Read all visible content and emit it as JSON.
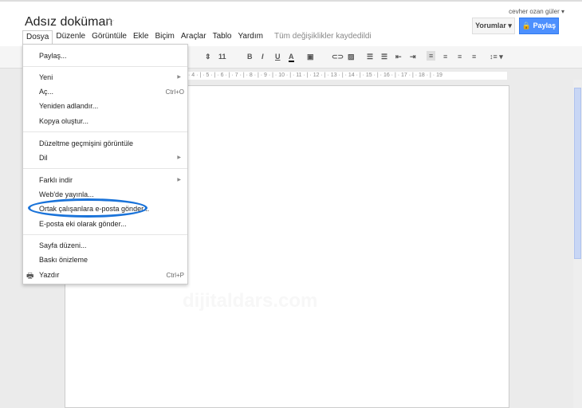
{
  "doc": {
    "title": "Adsız doküman",
    "star_icon": "star-icon"
  },
  "account": {
    "user": "cevher ozan güler ▾"
  },
  "buttons": {
    "comments": "Yorumlar ▾",
    "share": "Paylaş",
    "share_color": "#4d90fe"
  },
  "menubar": [
    "Dosya",
    "Düzenle",
    "Görüntüle",
    "Ekle",
    "Biçim",
    "Araçlar",
    "Tablo",
    "Yardım"
  ],
  "status": "Tüm değişiklikler kaydedildi",
  "toolbar": {
    "font_size": "11",
    "bold": "B",
    "italic": "I",
    "underline": "U",
    "text_color": "A"
  },
  "ruler": "· 4 · | · 5 · | · 6 · | · 7 · | · 8 · | · 9 · | · 10 · | · 11 · | · 12 · | · 13 · | · 14 · | · 15 · | · 16 · | · 17 · | · 18 · | · 19",
  "watermark": "dijitaldars.com",
  "file_menu": [
    {
      "label": "Paylaş..."
    },
    {
      "label": "Yeni",
      "submenu": true
    },
    {
      "label": "Aç...",
      "shortcut": "Ctrl+O"
    },
    {
      "label": "Yeniden adlandır..."
    },
    {
      "label": "Kopya oluştur..."
    },
    {
      "label": "Düzeltme geçmişini görüntüle"
    },
    {
      "label": "Dil",
      "submenu": true
    },
    {
      "label": "Farklı indir",
      "submenu": true
    },
    {
      "label": "Web'de yayınla..."
    },
    {
      "label": "Ortak çalışanlara e-posta gönder...",
      "highlighted": true
    },
    {
      "label": "E-posta eki olarak gönder..."
    },
    {
      "label": "Sayfa düzeni..."
    },
    {
      "label": "Baskı önizleme"
    },
    {
      "label": "Yazdır",
      "shortcut": "Ctrl+P",
      "icon": "printer-icon"
    }
  ]
}
